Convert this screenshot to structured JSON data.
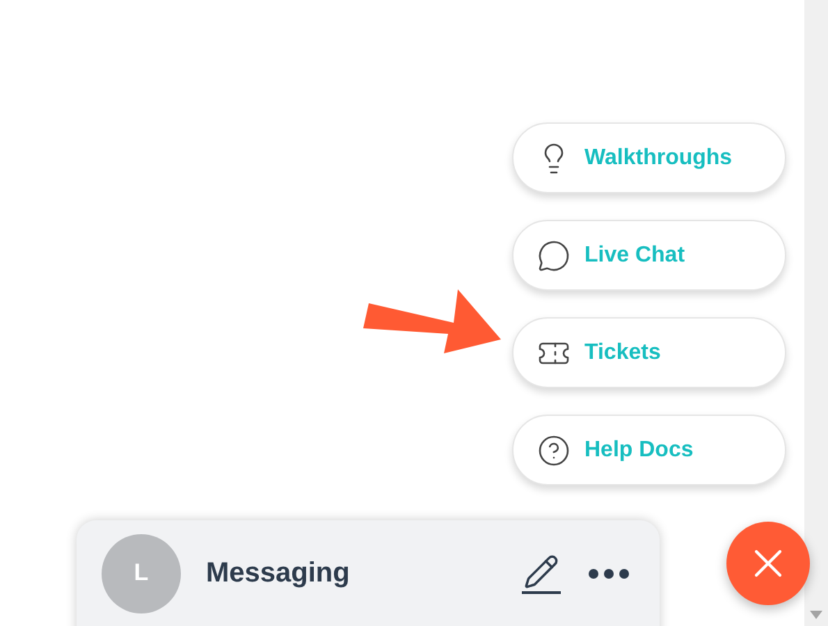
{
  "help_menu": [
    {
      "kind": "walkthroughs",
      "label": "Walkthroughs"
    },
    {
      "kind": "chat",
      "label": "Live Chat"
    },
    {
      "kind": "tickets",
      "label": "Tickets"
    },
    {
      "kind": "docs",
      "label": "Help Docs"
    }
  ],
  "messaging_bar": {
    "avatar_initial": "L",
    "title": "Messaging"
  }
}
